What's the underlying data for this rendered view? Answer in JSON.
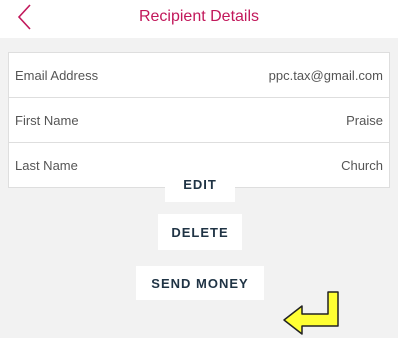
{
  "header": {
    "title": "Recipient Details",
    "back_icon": "chevron-left-icon"
  },
  "details": [
    {
      "label": "Email Address",
      "value": "ppc.tax@gmail.com"
    },
    {
      "label": "First Name",
      "value": "Praise"
    },
    {
      "label": "Last Name",
      "value": "Church"
    }
  ],
  "actions": {
    "edit_label": "EDIT",
    "delete_label": "DELETE",
    "send_label": "SEND MONEY"
  },
  "annotation": {
    "icon": "yellow-arrow-icon"
  },
  "colors": {
    "accent": "#c2185b",
    "button_text": "#1f3344",
    "background": "#f2f2f2",
    "arrow_fill": "#ffff33"
  }
}
